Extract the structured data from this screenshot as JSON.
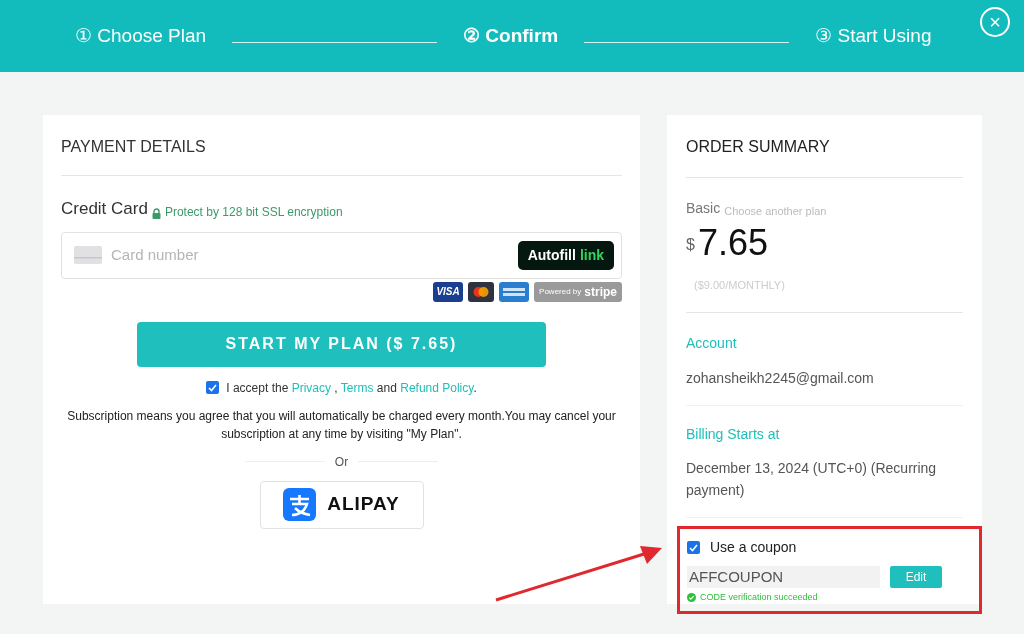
{
  "steps": [
    {
      "label": "① Choose Plan",
      "selected": false
    },
    {
      "label": "② Confirm",
      "selected": true
    },
    {
      "label": "③ Start Using",
      "selected": false
    }
  ],
  "close": "×",
  "payment": {
    "title": "PAYMENT DETAILS",
    "method": "Credit Card",
    "secure_note": "Protect by 128 bit SSL encryption",
    "card_placeholder": "Card number",
    "autofill": "Autofill",
    "autofill_brand": "link",
    "visa": "VISA",
    "stripe_prefix": "Powered by",
    "stripe_brand": "stripe",
    "submit": "START MY PLAN ($ 7.65)",
    "accept_checked": true,
    "accept_text": "I accept the",
    "privacy": "Privacy",
    "comma": ",",
    "terms": "Terms",
    "and": "and",
    "refund": "Refund Policy",
    "period": ".",
    "notice": "Subscription means you agree that you will automatically be charged every month.You may cancel your subscription at any time by visiting \"My Plan\".",
    "or": "Or",
    "alipay": "ALIPAY"
  },
  "summary": {
    "title": "ORDER SUMMARY",
    "plan": "Basic",
    "change_plan": "Choose another plan",
    "currency": "$",
    "price": "7.65",
    "regular": "($9.00/MONTHLY)",
    "account_label": "Account",
    "account": "zohansheikh2245@gmail.com",
    "billing_label": "Billing Starts at",
    "billing": "December 13, 2024 (UTC+0) (Recurring payment)",
    "coupon_checked": true,
    "coupon_label": "Use a coupon",
    "coupon_code": "AFFCOUPON",
    "edit": "Edit",
    "verification": "CODE verification succeeded"
  }
}
